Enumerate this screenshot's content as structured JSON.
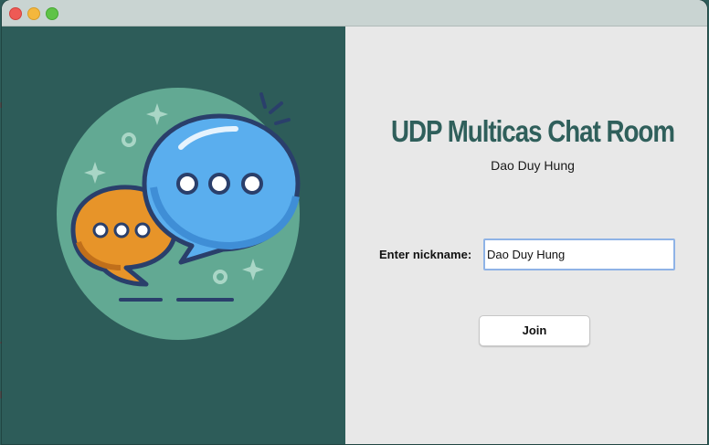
{
  "window": {
    "controls": [
      "close",
      "minimize",
      "maximize"
    ]
  },
  "chat_illustration": {
    "icon": "chat-bubbles-icon",
    "colors": {
      "circle": "#62a993",
      "blue_bubble": "#5aaeee",
      "orange_bubble": "#e79429",
      "outline": "#2a3f6b"
    }
  },
  "app": {
    "title": "UDP Multicas Chat Room",
    "author": "Dao Duy Hung"
  },
  "form": {
    "nickname_label": "Enter nickname:",
    "nickname_value": "Dao Duy Hung",
    "join_label": "Join"
  },
  "colors": {
    "panel_dark": "#2d5c59",
    "title_teal": "#2f5f5b",
    "panel_light": "#e8e8e8",
    "input_focus": "#8fb3e6"
  }
}
